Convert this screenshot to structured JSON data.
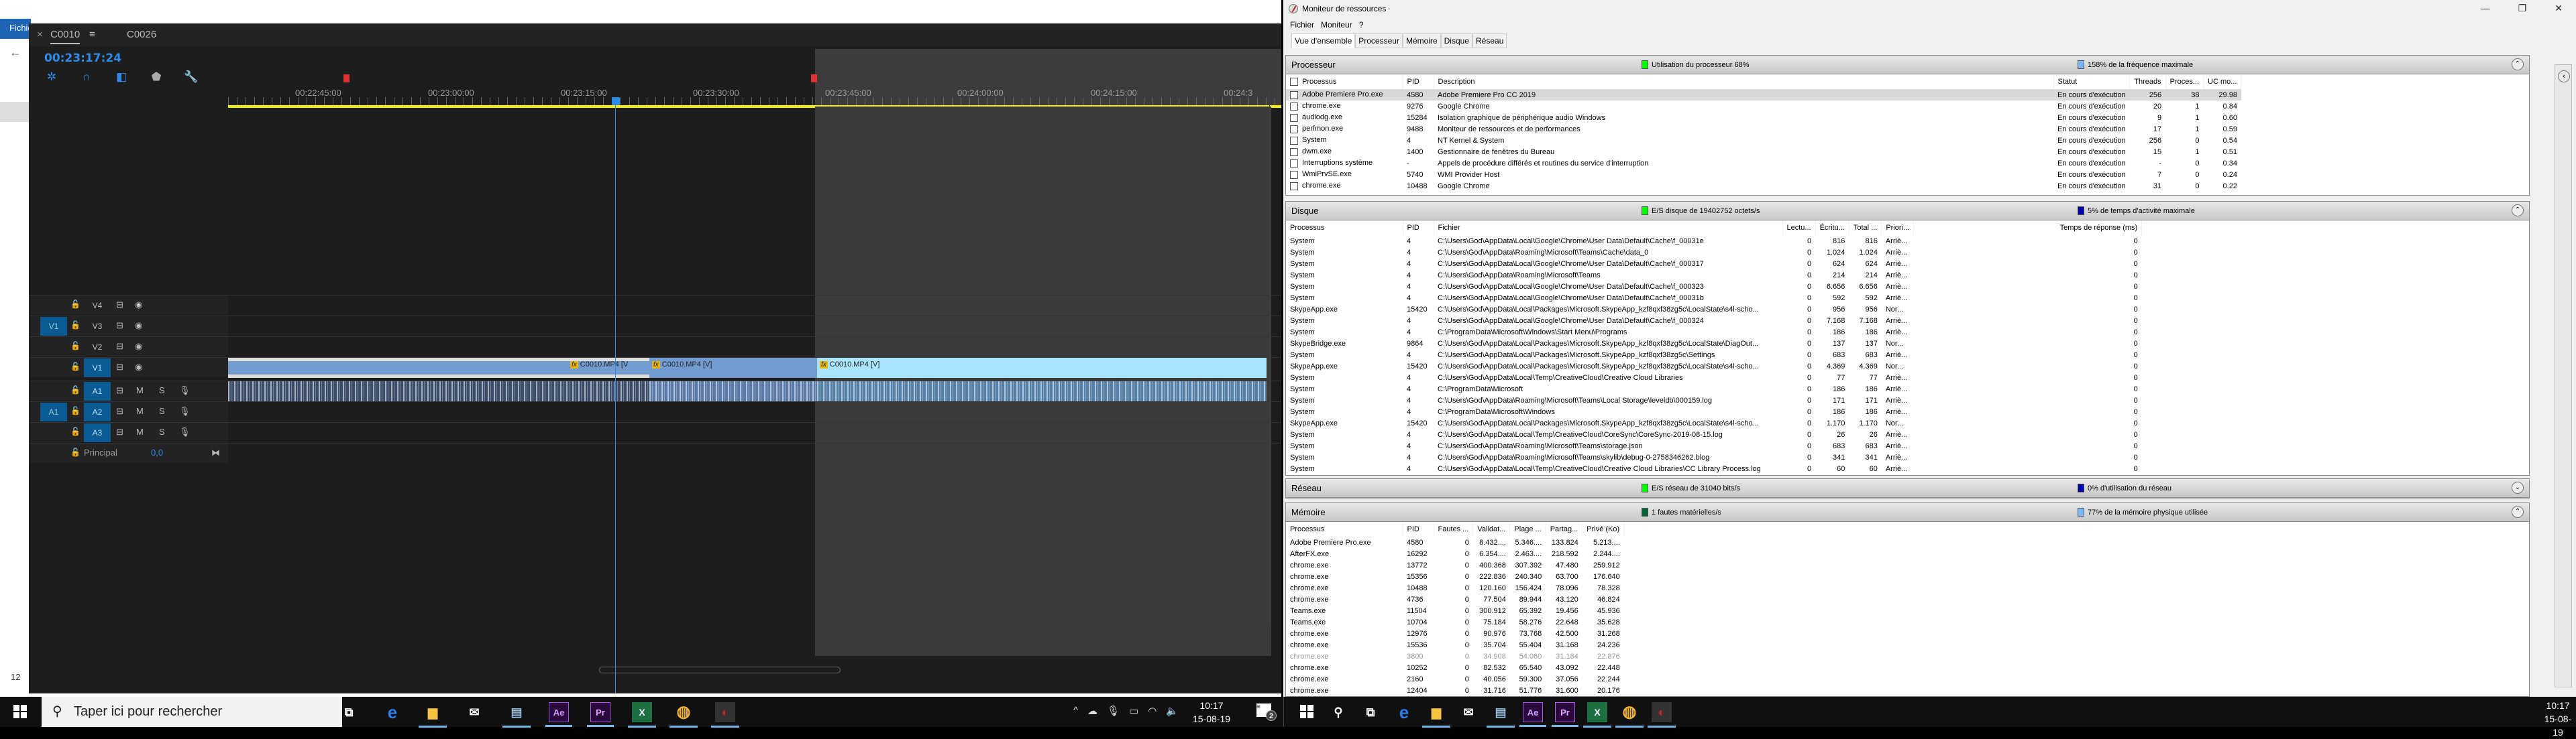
{
  "explorer": {
    "ribbon_label": "Fichier",
    "status_num": "12"
  },
  "premiere": {
    "tabs": [
      {
        "label": "C0010",
        "active": true
      },
      {
        "label": "C0026",
        "active": false
      }
    ],
    "timecode": "00:23:17:24",
    "tools": [
      "ripple-icon",
      "snap-magnet-icon",
      "linked-selection-icon",
      "marker-icon",
      "wrench-icon"
    ],
    "ruler_labels": [
      "00:22:45:00",
      "00:23:00:00",
      "00:23:15:00",
      "00:23:30:00",
      "00:23:45:00",
      "00:24:00:00",
      "00:24:15:00",
      "00:24:3"
    ],
    "video_tracks": [
      {
        "name": "V4",
        "source": ""
      },
      {
        "name": "V3",
        "source": "V1"
      },
      {
        "name": "V2",
        "source": ""
      },
      {
        "name": "V1",
        "source": "",
        "targeted": true
      }
    ],
    "audio_tracks": [
      {
        "name": "A1",
        "source": "",
        "targeted": true,
        "m": "M",
        "s": "S"
      },
      {
        "name": "A2",
        "source": "A1",
        "targeted": true,
        "m": "M",
        "s": "S"
      },
      {
        "name": "A3",
        "source": "",
        "targeted": true,
        "m": "M",
        "s": "S"
      }
    ],
    "master": {
      "label": "Principal",
      "value": "0,0"
    },
    "clips": [
      {
        "label": "C0010.MP4 [V",
        "fx": "fx"
      },
      {
        "label": "C0010.MP4 [V]",
        "fx": "fx"
      },
      {
        "label": "C0010.MP4 [V]",
        "fx": "fx"
      }
    ]
  },
  "resmon": {
    "title": "Moniteur de ressources",
    "menu": [
      "Fichier",
      "Moniteur",
      "?"
    ],
    "tabs": [
      "Vue d'ensemble",
      "Processeur",
      "Mémoire",
      "Disque",
      "Réseau"
    ],
    "cpu": {
      "title": "Processeur",
      "ind1": "Utilisation du processeur 68%",
      "ind2": "158% de la fréquence maximale",
      "columns": [
        "Processus",
        "PID",
        "Description",
        "Statut",
        "Threads",
        "Proces...",
        "UC mo..."
      ],
      "rows": [
        [
          "Adobe Premiere Pro.exe",
          "4580",
          "Adobe Premiere Pro CC 2019",
          "En cours d'exécution",
          "256",
          "38",
          "29.98"
        ],
        [
          "chrome.exe",
          "9276",
          "Google Chrome",
          "En cours d'exécution",
          "20",
          "1",
          "0.84"
        ],
        [
          "audiodg.exe",
          "15284",
          "Isolation graphique de périphérique audio Windows",
          "En cours d'exécution",
          "9",
          "1",
          "0.60"
        ],
        [
          "perfmon.exe",
          "9488",
          "Moniteur de ressources et de performances",
          "En cours d'exécution",
          "17",
          "1",
          "0.59"
        ],
        [
          "System",
          "4",
          "NT Kernel & System",
          "En cours d'exécution",
          "256",
          "0",
          "0.54"
        ],
        [
          "dwm.exe",
          "1400",
          "Gestionnaire de fenêtres du Bureau",
          "En cours d'exécution",
          "15",
          "1",
          "0.51"
        ],
        [
          "Interruptions système",
          "-",
          "Appels de procédure différés et routines du service d'interruption",
          "En cours d'exécution",
          "-",
          "0",
          "0.34"
        ],
        [
          "WmiPrvSE.exe",
          "5740",
          "WMI Provider Host",
          "En cours d'exécution",
          "7",
          "0",
          "0.24"
        ],
        [
          "chrome.exe",
          "10488",
          "Google Chrome",
          "En cours d'exécution",
          "31",
          "0",
          "0.22"
        ]
      ]
    },
    "disk": {
      "title": "Disque",
      "ind1": "E/S disque de 19402752 octets/s",
      "ind2": "5% de temps d'activité maximale",
      "columns": [
        "Processus",
        "PID",
        "Fichier",
        "Lectu...",
        "Écritu...",
        "Total ...",
        "Priori...",
        "Temps de réponse (ms)"
      ],
      "rows": [
        [
          "System",
          "4",
          "C:\\Users\\God\\AppData\\Local\\Google\\Chrome\\User Data\\Default\\Cache\\f_00031e",
          "0",
          "816",
          "816",
          "Arriè...",
          "0"
        ],
        [
          "System",
          "4",
          "C:\\Users\\God\\AppData\\Roaming\\Microsoft\\Teams\\Cache\\data_0",
          "0",
          "1.024",
          "1.024",
          "Arriè...",
          "0"
        ],
        [
          "System",
          "4",
          "C:\\Users\\God\\AppData\\Local\\Google\\Chrome\\User Data\\Default\\Cache\\f_000317",
          "0",
          "624",
          "624",
          "Arriè...",
          "0"
        ],
        [
          "System",
          "4",
          "C:\\Users\\God\\AppData\\Roaming\\Microsoft\\Teams",
          "0",
          "214",
          "214",
          "Arriè...",
          "0"
        ],
        [
          "System",
          "4",
          "C:\\Users\\God\\AppData\\Local\\Google\\Chrome\\User Data\\Default\\Cache\\f_000323",
          "0",
          "6.656",
          "6.656",
          "Arriè...",
          "0"
        ],
        [
          "System",
          "4",
          "C:\\Users\\God\\AppData\\Local\\Google\\Chrome\\User Data\\Default\\Cache\\f_00031b",
          "0",
          "592",
          "592",
          "Arriè...",
          "0"
        ],
        [
          "SkypeApp.exe",
          "15420",
          "C:\\Users\\God\\AppData\\Local\\Packages\\Microsoft.SkypeApp_kzf8qxf38zg5c\\LocalState\\s4l-scho...",
          "0",
          "956",
          "956",
          "Nor...",
          "0"
        ],
        [
          "System",
          "4",
          "C:\\Users\\God\\AppData\\Local\\Google\\Chrome\\User Data\\Default\\Cache\\f_000324",
          "0",
          "7.168",
          "7.168",
          "Arriè...",
          "0"
        ],
        [
          "System",
          "4",
          "C:\\ProgramData\\Microsoft\\Windows\\Start Menu\\Programs",
          "0",
          "186",
          "186",
          "Arriè...",
          "0"
        ],
        [
          "SkypeBridge.exe",
          "9864",
          "C:\\Users\\God\\AppData\\Local\\Packages\\Microsoft.SkypeApp_kzf8qxf38zg5c\\LocalState\\DiagOut...",
          "0",
          "137",
          "137",
          "Nor...",
          "0"
        ],
        [
          "System",
          "4",
          "C:\\Users\\God\\AppData\\Local\\Packages\\Microsoft.SkypeApp_kzf8qxf38zg5c\\Settings",
          "0",
          "683",
          "683",
          "Arriè...",
          "0"
        ],
        [
          "SkypeApp.exe",
          "15420",
          "C:\\Users\\God\\AppData\\Local\\Packages\\Microsoft.SkypeApp_kzf8qxf38zg5c\\LocalState\\s4l-scho...",
          "0",
          "4.369",
          "4.369",
          "Nor...",
          "0"
        ],
        [
          "System",
          "4",
          "C:\\Users\\God\\AppData\\Local\\Temp\\CreativeCloud\\Creative Cloud Libraries",
          "0",
          "77",
          "77",
          "Arriè...",
          "0"
        ],
        [
          "System",
          "4",
          "C:\\ProgramData\\Microsoft",
          "0",
          "186",
          "186",
          "Arriè...",
          "0"
        ],
        [
          "System",
          "4",
          "C:\\Users\\God\\AppData\\Roaming\\Microsoft\\Teams\\Local Storage\\leveldb\\000159.log",
          "0",
          "171",
          "171",
          "Arriè...",
          "0"
        ],
        [
          "System",
          "4",
          "C:\\ProgramData\\Microsoft\\Windows",
          "0",
          "186",
          "186",
          "Arriè...",
          "0"
        ],
        [
          "SkypeApp.exe",
          "15420",
          "C:\\Users\\God\\AppData\\Local\\Packages\\Microsoft.SkypeApp_kzf8qxf38zg5c\\LocalState\\s4l-scho...",
          "0",
          "1.170",
          "1.170",
          "Nor...",
          "0"
        ],
        [
          "System",
          "4",
          "C:\\Users\\God\\AppData\\Local\\Temp\\CreativeCloud\\CoreSync\\CoreSync-2019-08-15.log",
          "0",
          "26",
          "26",
          "Arriè...",
          "0"
        ],
        [
          "System",
          "4",
          "C:\\Users\\God\\AppData\\Roaming\\Microsoft\\Teams\\storage.json",
          "0",
          "683",
          "683",
          "Arriè...",
          "0"
        ],
        [
          "System",
          "4",
          "C:\\Users\\God\\AppData\\Roaming\\Microsoft\\Teams\\skylib\\debug-0-2758346262.blog",
          "0",
          "341",
          "341",
          "Arriè...",
          "0"
        ],
        [
          "System",
          "4",
          "C:\\Users\\God\\AppData\\Local\\Temp\\CreativeCloud\\Creative Cloud Libraries\\CC Library Process.log",
          "0",
          "60",
          "60",
          "Arriè...",
          "0"
        ]
      ]
    },
    "network": {
      "title": "Réseau",
      "ind1": "E/S réseau de 31040 bits/s",
      "ind2": "0% d'utilisation du réseau"
    },
    "memory": {
      "title": "Mémoire",
      "ind1": "1 fautes matérielles/s",
      "ind2": "77% de la mémoire physique utilisée",
      "columns": [
        "Processus",
        "PID",
        "Fautes ...",
        "Validat...",
        "Plage ...",
        "Partag...",
        "Privé (Ko)"
      ],
      "rows": [
        [
          "Adobe Premiere Pro.exe",
          "4580",
          "0",
          "8.432....",
          "5.346....",
          "133.824",
          "5.213...."
        ],
        [
          "AfterFX.exe",
          "16292",
          "0",
          "6.354....",
          "2.463....",
          "218.592",
          "2.244...."
        ],
        [
          "chrome.exe",
          "13772",
          "0",
          "400.368",
          "307.392",
          "47.480",
          "259.912"
        ],
        [
          "chrome.exe",
          "15356",
          "0",
          "222.836",
          "240.340",
          "63.700",
          "176.640"
        ],
        [
          "chrome.exe",
          "10488",
          "0",
          "120.160",
          "156.424",
          "78.096",
          "78.328"
        ],
        [
          "chrome.exe",
          "4736",
          "0",
          "77.504",
          "89.944",
          "43.120",
          "46.824"
        ],
        [
          "Teams.exe",
          "11504",
          "0",
          "300.912",
          "65.392",
          "19.456",
          "45.936"
        ],
        [
          "Teams.exe",
          "10704",
          "0",
          "75.184",
          "58.276",
          "22.648",
          "35.628"
        ],
        [
          "chrome.exe",
          "12976",
          "0",
          "90.976",
          "73.768",
          "42.500",
          "31.268"
        ],
        [
          "chrome.exe",
          "15536",
          "0",
          "35.704",
          "55.404",
          "31.168",
          "24.236"
        ],
        [
          "chrome.exe",
          "3800",
          "0",
          "34.908",
          "54.060",
          "31.184",
          "22.876"
        ],
        [
          "chrome.exe",
          "10252",
          "0",
          "82.532",
          "65.540",
          "43.092",
          "22.448"
        ],
        [
          "chrome.exe",
          "2160",
          "0",
          "40.056",
          "59.300",
          "37.056",
          "22.244"
        ],
        [
          "chrome.exe",
          "12404",
          "0",
          "31.716",
          "51.776",
          "31.600",
          "20.176"
        ]
      ]
    }
  },
  "taskbar": {
    "search_placeholder": "Taper ici pour rechercher",
    "left_clock": {
      "time": "10:17",
      "date": "15-08-19"
    },
    "right_clock": {
      "time": "10:17",
      "date": "15-08-19"
    },
    "notifications": "2",
    "apps": [
      "task-view",
      "edge",
      "file-explorer",
      "mail",
      "resource-monitor",
      "after-effects",
      "premiere-pro",
      "excel",
      "chrome",
      "perfmon"
    ]
  },
  "colors": {
    "accent": "#2d8ceb",
    "work_area": "#f2ee00",
    "marker": "#d33333",
    "clip_video": "#729ccf",
    "clip_selected": "#aae4ff"
  }
}
